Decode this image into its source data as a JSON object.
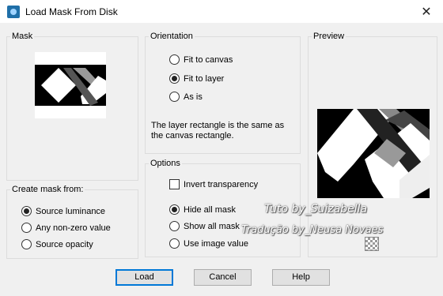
{
  "window": {
    "title": "Load Mask From Disk",
    "close_glyph": "✕"
  },
  "mask_group": {
    "label": "Mask"
  },
  "create_group": {
    "label": "Create mask from:",
    "options": [
      {
        "label": "Source luminance",
        "checked": true
      },
      {
        "label": "Any non-zero value",
        "checked": false
      },
      {
        "label": "Source opacity",
        "checked": false
      }
    ]
  },
  "orientation_group": {
    "label": "Orientation",
    "options": [
      {
        "label": "Fit to canvas",
        "checked": false
      },
      {
        "label": "Fit to layer",
        "checked": true
      },
      {
        "label": "As is",
        "checked": false
      }
    ],
    "description": "The layer rectangle is the same as the canvas rectangle."
  },
  "options_group": {
    "label": "Options",
    "invert_label": "Invert transparency",
    "invert_checked": false,
    "options": [
      {
        "label": "Hide all mask",
        "checked": true
      },
      {
        "label": "Show all mask",
        "checked": false
      },
      {
        "label": "Use image value",
        "checked": false
      }
    ]
  },
  "preview_group": {
    "label": "Preview"
  },
  "buttons": {
    "load": "Load",
    "cancel": "Cancel",
    "help": "Help"
  },
  "watermark": {
    "line1": "Tuto by_Suizabella",
    "line2": "Tradução by_Neusa Novaes"
  },
  "icons": {
    "app": "paintshop-icon",
    "close": "close-icon",
    "nav": "navigator-icon"
  }
}
